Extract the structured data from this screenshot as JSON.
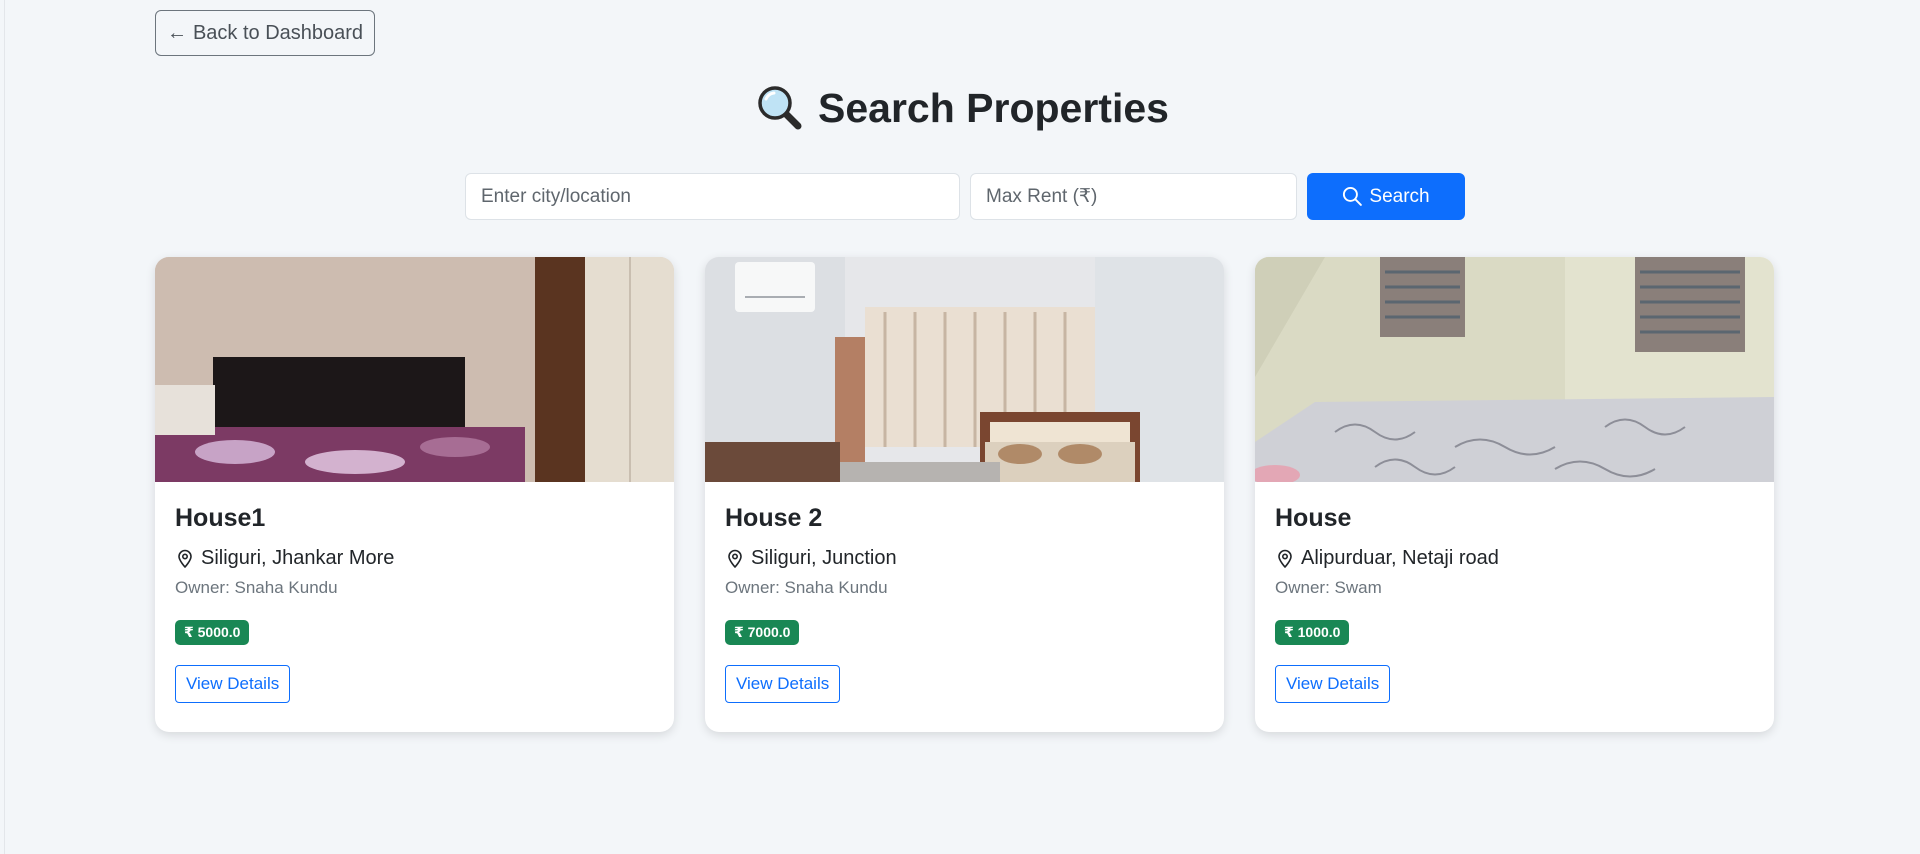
{
  "nav": {
    "back_arrow": "←",
    "back_label": "Back to Dashboard"
  },
  "header": {
    "title": "Search Properties",
    "icon": "magnifying-glass-icon"
  },
  "search": {
    "location_placeholder": "Enter city/location",
    "rent_placeholder": "Max Rent (₹)",
    "button_label": "Search",
    "button_icon": "search-icon"
  },
  "colors": {
    "primary": "#0d6efd",
    "success": "#198754",
    "background": "#f3f6f9"
  },
  "properties": [
    {
      "title": "House1",
      "location": "Siliguri, Jhankar More",
      "owner": "Owner: Snaha Kundu",
      "price": "₹ 5000.0",
      "action": "View Details"
    },
    {
      "title": "House 2",
      "location": "Siliguri, Junction",
      "owner": "Owner: Snaha Kundu",
      "price": "₹ 7000.0",
      "action": "View Details"
    },
    {
      "title": "House",
      "location": "Alipurduar, Netaji road",
      "owner": "Owner: Swam",
      "price": "₹ 1000.0",
      "action": "View Details"
    }
  ]
}
